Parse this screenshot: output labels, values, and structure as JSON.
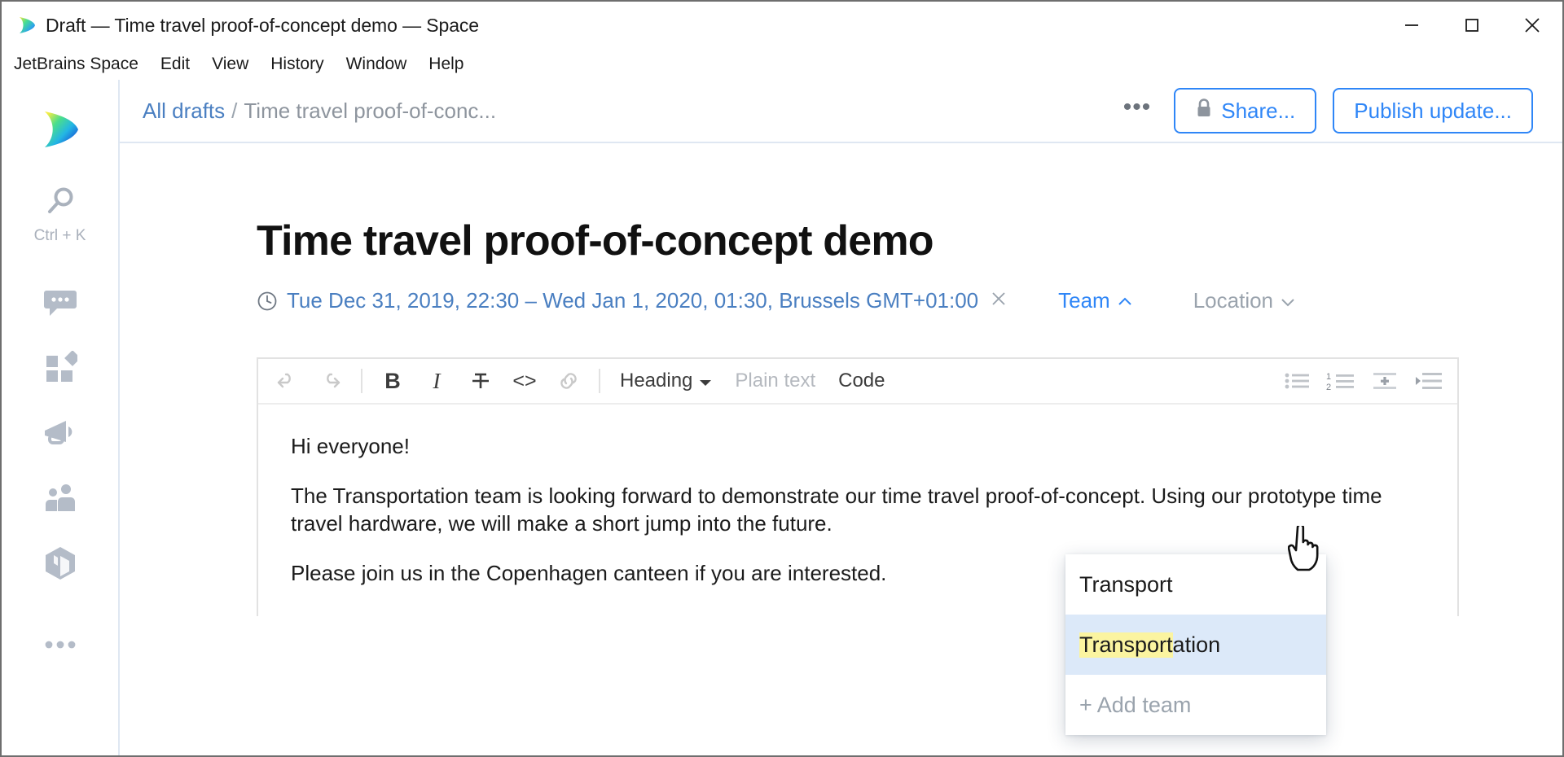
{
  "window": {
    "title": "Draft — Time travel proof-of-concept demo — Space",
    "logo_icon": "space-logo-icon",
    "minimize_icon": "minimize-icon",
    "maximize_icon": "maximize-icon",
    "close_icon": "close-icon"
  },
  "menubar": {
    "items": [
      {
        "label": "JetBrains Space"
      },
      {
        "label": "Edit"
      },
      {
        "label": "View"
      },
      {
        "label": "History"
      },
      {
        "label": "Window"
      },
      {
        "label": "Help"
      }
    ]
  },
  "sidebar": {
    "logo_icon": "space-logo-icon",
    "search": {
      "icon": "search-icon",
      "shortcut": "Ctrl + K"
    },
    "items": [
      {
        "icon": "chat-bubble-icon",
        "name": "chats"
      },
      {
        "icon": "blocks-icon",
        "name": "projects"
      },
      {
        "icon": "megaphone-icon",
        "name": "blog"
      },
      {
        "icon": "people-icon",
        "name": "teams"
      },
      {
        "icon": "cube-icon",
        "name": "packages"
      },
      {
        "icon": "more-dots-icon",
        "name": "more"
      }
    ]
  },
  "topbar": {
    "breadcrumb": {
      "root": "All drafts",
      "separator": "/",
      "current": "Time travel proof-of-conc..."
    },
    "more_label": "•••",
    "share_label": "Share...",
    "share_icon": "lock-icon",
    "publish_label": "Publish update..."
  },
  "document": {
    "title": "Time travel proof-of-concept demo",
    "meta": {
      "clock_icon": "clock-icon",
      "date_range": "Tue Dec 31, 2019, 22:30 – Wed Jan 1, 2020, 01:30, Brussels GMT+01:00",
      "date_clear_icon": "close-icon",
      "team_label": "Team",
      "team_chevron": "chevron-up-icon",
      "location_label": "Location",
      "location_chevron": "chevron-down-icon"
    },
    "editor": {
      "toolbar": {
        "undo_icon": "undo-icon",
        "redo_icon": "redo-icon",
        "bold_label": "B",
        "italic_label": "I",
        "strikethrough_label": "T",
        "code_label": "<>",
        "link_icon": "link-icon",
        "heading_label": "Heading",
        "heading_chevron": "chevron-down-icon",
        "plain_text_label": "Plain text",
        "code_block_label": "Code",
        "bullet_list_icon": "bullet-list-icon",
        "numbered_list_icon": "numbered-list-icon",
        "insert_line_icon": "insert-line-icon",
        "outdent_icon": "outdent-icon"
      },
      "paragraphs": [
        "Hi everyone!",
        "The Transportation team is looking forward to demonstrate our time travel proof-of-concept. Using our prototype time travel hardware, we will make a short jump into the future.",
        "Please join us in the Copenhagen canteen if you are interested."
      ]
    }
  },
  "team_popup": {
    "items": [
      {
        "label": "Transport",
        "highlight": "",
        "rest": "Transport",
        "selected": false
      },
      {
        "label": "Transportation",
        "highlight": "Transport",
        "rest": "ation",
        "selected": true
      },
      {
        "label": "+ Add team",
        "selected": false,
        "is_add": true
      }
    ]
  },
  "colors": {
    "accent_blue": "#2f86f7",
    "link_blue": "#4a7fc1",
    "muted_gray": "#9aa3ad",
    "selected_row": "#dce9f9",
    "highlight_yellow": "#fbf4a0",
    "border_light": "#dfe7f2"
  }
}
